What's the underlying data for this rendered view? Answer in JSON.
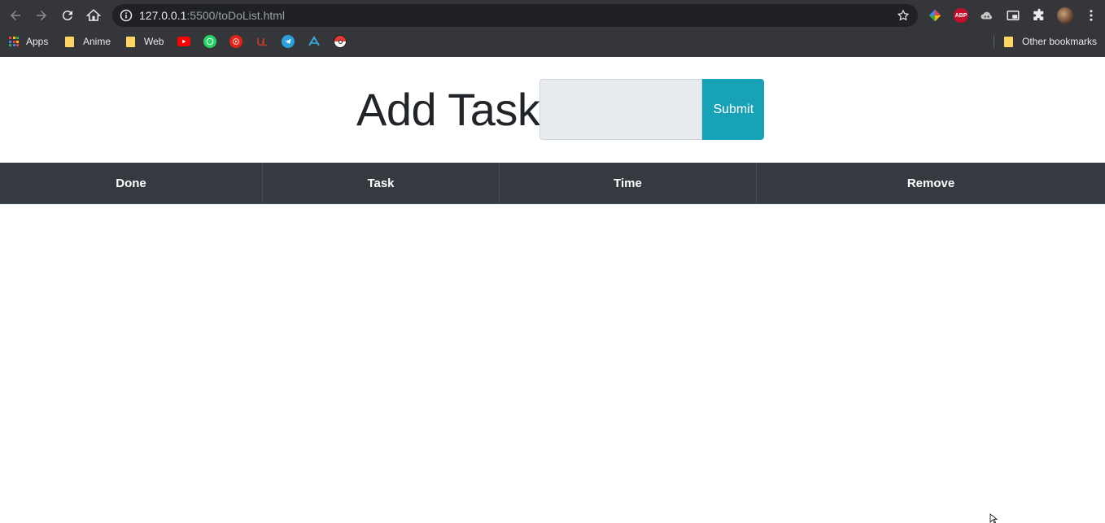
{
  "browser": {
    "url_host": "127.0.0.1",
    "url_rest": ":5500/toDoList.html",
    "bookmarks": {
      "apps_label": "Apps",
      "folder_anime": "Anime",
      "folder_web": "Web",
      "other_bookmarks": "Other bookmarks"
    },
    "extensions": {
      "abp_label": "ABP"
    }
  },
  "page": {
    "heading": "Add Task",
    "input_value": "",
    "submit_label": "Submit",
    "table": {
      "columns": [
        "Done",
        "Task",
        "Time",
        "Remove"
      ],
      "rows": []
    }
  },
  "colors": {
    "accent": "#17a2b8",
    "table_header_bg": "#343a40",
    "input_bg": "#e9ecef"
  }
}
